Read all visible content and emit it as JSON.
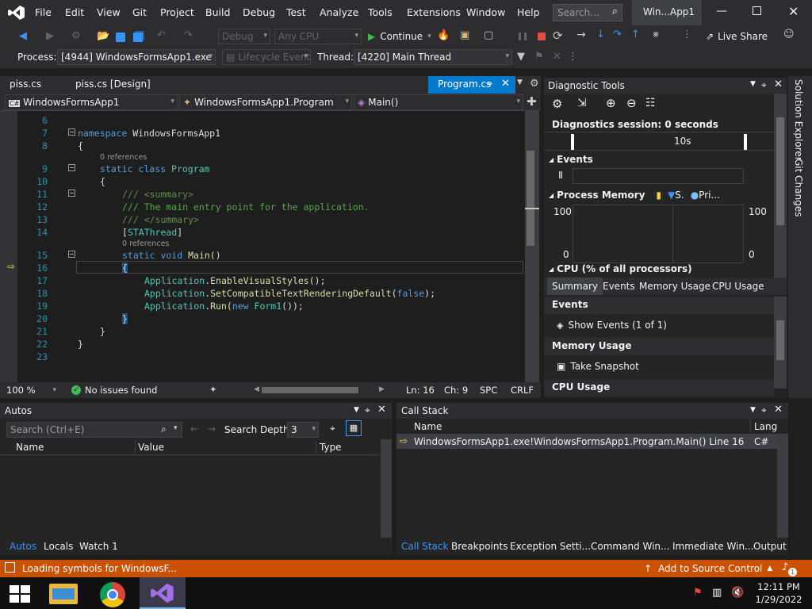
{
  "menu": {
    "items": [
      "File",
      "Edit",
      "View",
      "Git",
      "Project",
      "Build",
      "Debug",
      "Test",
      "Analyze",
      "Tools",
      "Extensions",
      "Window",
      "Help"
    ],
    "search_placeholder": "Search...",
    "window_title": "Win...App1"
  },
  "toolbar": {
    "config": "Debug",
    "platform": "Any CPU",
    "continue_label": "Continue",
    "live_share": "Live Share"
  },
  "debugbar": {
    "process_label": "Process:",
    "process_value": "[4944] WindowsFormsApp1.exe",
    "lifecycle": "Lifecycle Events",
    "thread_label": "Thread:",
    "thread_value": "[4220] Main Thread"
  },
  "doctabs": [
    "piss.cs",
    "piss.cs [Design]",
    "Program.cs"
  ],
  "navbar": {
    "project": "WindowsFormsApp1",
    "class": "WindowsFormsApp1.Program",
    "member": "Main()",
    "cs_badge": "C#"
  },
  "code": {
    "line_numbers": [
      "6",
      "7",
      "8",
      "9",
      "10",
      "11",
      "12",
      "13",
      "14",
      "15",
      "16",
      "17",
      "18",
      "19",
      "20",
      "21",
      "22",
      "23"
    ],
    "refs": "0 references",
    "l7a": "namespace ",
    "l7b": "WindowsFormsApp1",
    "brace_open": "{",
    "brace_close": "}",
    "l9a": "static class ",
    "l9b": "Program",
    "l11": "/// <summary>",
    "l12": "/// The main entry point for the application.",
    "l13": "/// </summary>",
    "l14a": "[",
    "l14b": "STAThread",
    "l14c": "]",
    "l15a": "static void ",
    "l15b": "Main",
    "l15c": "()",
    "l17a": "Application",
    "l17b": ".",
    "l17c": "EnableVisualStyles",
    "l17d": "();",
    "l18a": "Application",
    "l18b": ".",
    "l18c": "SetCompatibleTextRenderingDefault",
    "l18d": "(",
    "l18e": "false",
    "l18f": ");",
    "l19a": "Application",
    "l19b": ".",
    "l19c": "Run",
    "l19d": "(",
    "l19e": "new ",
    "l19f": "Form1",
    "l19g": "());"
  },
  "editor_status": {
    "zoom": "100 %",
    "issues": "No issues found",
    "ln": "Ln: 16",
    "ch": "Ch: 9",
    "spc": "SPC",
    "crlf": "CRLF"
  },
  "diag": {
    "title": "Diagnostic Tools",
    "session": "Diagnostics session: 0 seconds",
    "timeline": "10s",
    "events": "Events",
    "process_memory": "Process Memory",
    "snapshot_short": "S.",
    "private_short": "Pri...",
    "mem_max_left": "100",
    "mem_min_left": "0",
    "mem_max_right": "100",
    "mem_min_right": "0",
    "cpu": "CPU (% of all processors)",
    "tabs": [
      "Summary",
      "Events",
      "Memory Usage",
      "CPU Usage"
    ],
    "sec_events": "Events",
    "show_events": "Show Events (1 of 1)",
    "sec_memory": "Memory Usage",
    "take_snapshot": "Take Snapshot",
    "sec_cpu": "CPU Usage"
  },
  "right_strip": {
    "solution_explorer": "Solution Explorer",
    "git_changes": "Git Changes"
  },
  "autos": {
    "title": "Autos",
    "search_placeholder": "Search (Ctrl+E)",
    "depth_label": "Search Depth:",
    "depth_value": "3",
    "cols": [
      "Name",
      "Value",
      "Type"
    ],
    "tabs": [
      "Autos",
      "Locals",
      "Watch 1"
    ]
  },
  "callstack": {
    "title": "Call Stack",
    "cols": [
      "Name",
      "Lang"
    ],
    "row_name": "WindowsFormsApp1.exe!WindowsFormsApp1.Program.Main() Line 16",
    "row_lang": "C#",
    "tabs": [
      "Call Stack",
      "Breakpoints",
      "Exception Setti...",
      "Command Win...",
      "Immediate Win...",
      "Output"
    ]
  },
  "statusbar": {
    "loading": "Loading symbols for WindowsF...",
    "source_control": "Add to Source Control",
    "notif_count": "1"
  },
  "taskbar": {
    "time": "12:11 PM",
    "date": "1/29/2022"
  },
  "colors": {
    "accent": "#007acc",
    "status_orange": "#ca5100"
  }
}
